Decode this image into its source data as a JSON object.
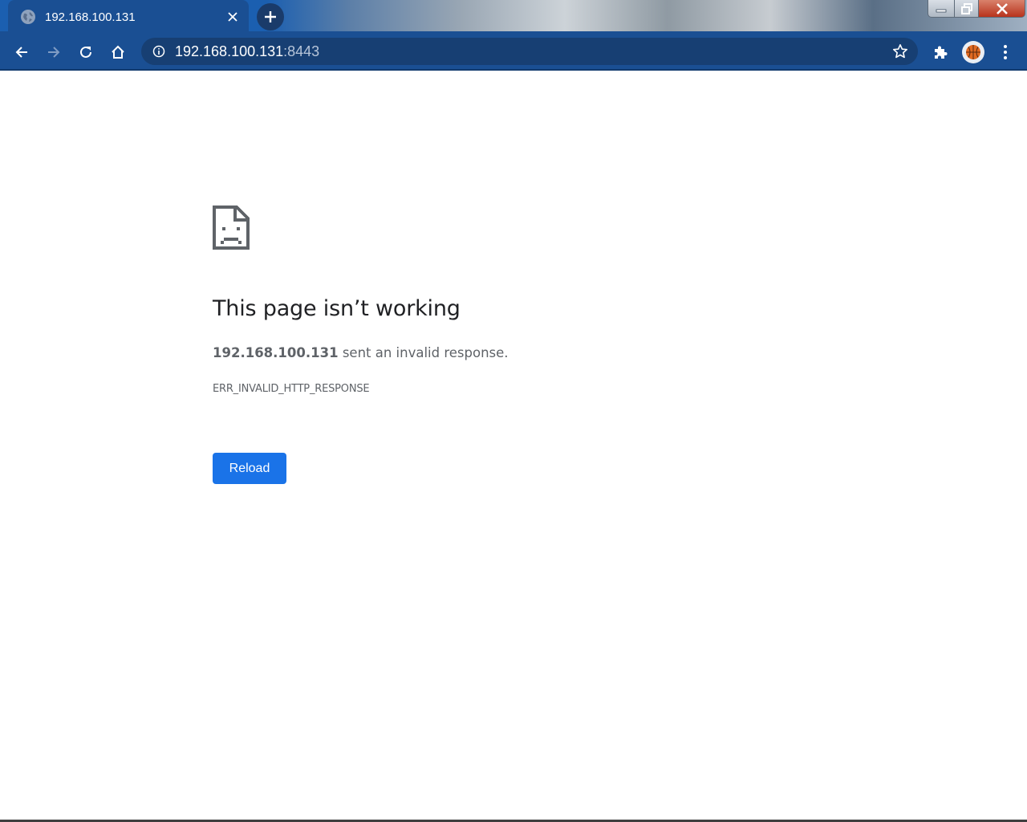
{
  "tab": {
    "title": "192.168.100.131",
    "favicon": "globe-icon"
  },
  "toolbar": {
    "url_host": "192.168.100.131",
    "url_port": ":8443"
  },
  "error_page": {
    "heading": "This page isn’t working",
    "host": "192.168.100.131",
    "summary_suffix": " sent an invalid response.",
    "error_code": "ERR_INVALID_HTTP_RESPONSE",
    "reload_label": "Reload"
  },
  "colors": {
    "chrome_dark_blue": "#1a4f93",
    "omnibox": "#173f73",
    "reload_button": "#1a73e8",
    "heading_text": "#202124",
    "body_text": "#5f6368"
  },
  "icons": [
    "globe-icon",
    "tab-close-icon",
    "plus-icon",
    "minimize-icon",
    "maximize-icon",
    "window-close-icon",
    "back-arrow-icon",
    "forward-arrow-icon",
    "reload-icon",
    "home-icon",
    "info-icon",
    "star-icon",
    "extensions-puzzle-icon",
    "avatar",
    "menu-kebab-icon",
    "sad-page-icon"
  ]
}
